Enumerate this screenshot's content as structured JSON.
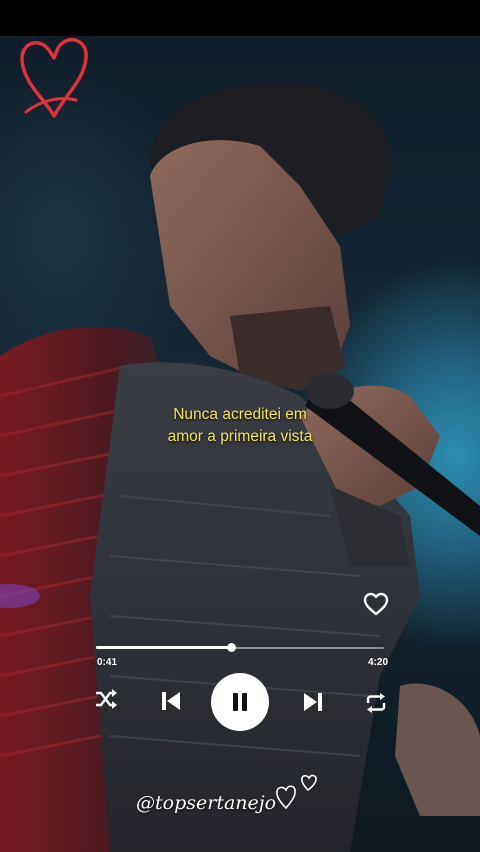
{
  "lyrics": {
    "line1": "Nunca acreditei em",
    "line2": "amor a primeira vista"
  },
  "player": {
    "current_time": "0:41",
    "total_time": "4:20",
    "progress": 0.47,
    "state": "playing",
    "controls": [
      "shuffle-icon",
      "previous-icon",
      "pause-icon",
      "next-icon",
      "repeat-icon"
    ],
    "like_icon": "heart-outline-icon"
  },
  "watermark": "@topsertanejo",
  "decor": {
    "logo_icon": "heart-icon",
    "logo_color": "#e0323e",
    "lyrics_color": "#f2e45a"
  }
}
